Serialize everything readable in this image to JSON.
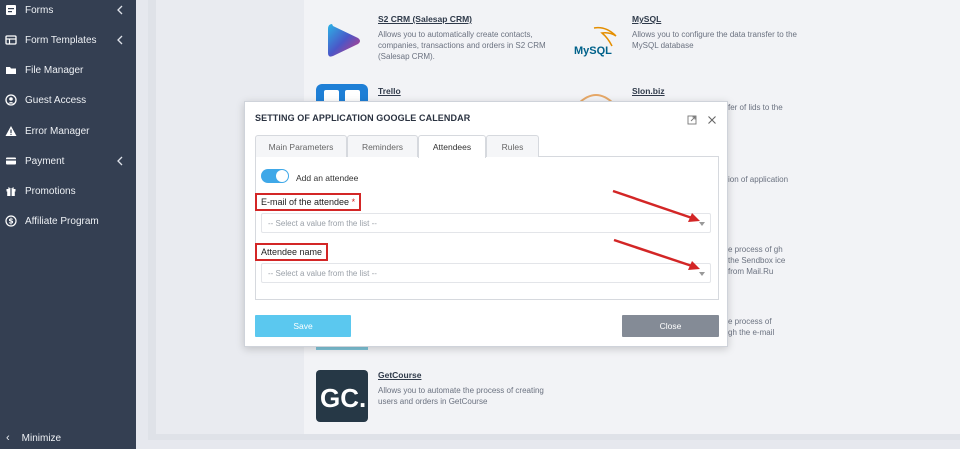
{
  "sidebar": {
    "items": [
      {
        "label": "Forms",
        "icon": "form-icon",
        "chevron": true
      },
      {
        "label": "Form Templates",
        "icon": "template-icon",
        "chevron": true
      },
      {
        "label": "File Manager",
        "icon": "folder-icon",
        "chevron": false
      },
      {
        "label": "Guest Access",
        "icon": "user-circle-icon",
        "chevron": false
      },
      {
        "label": "Error Manager",
        "icon": "warning-icon",
        "chevron": false
      },
      {
        "label": "Payment",
        "icon": "card-icon",
        "chevron": true
      },
      {
        "label": "Promotions",
        "icon": "gift-icon",
        "chevron": false
      },
      {
        "label": "Affiliate Program",
        "icon": "dollar-icon",
        "chevron": false
      }
    ],
    "minimize_label": "Minimize"
  },
  "integrations": {
    "s2crm": {
      "title": "S2 CRM (Salesap CRM)",
      "description": "Allows you to automatically create contacts, companies, transactions and orders in S2 CRM (Salesap CRM)."
    },
    "mysql": {
      "title": "MySQL",
      "description": "Allows you to configure the data transfer to the MySQL database",
      "logo_text": "MySQL"
    },
    "trello": {
      "title": "Trello"
    },
    "slon": {
      "title": "Slon.biz",
      "description_fragment": "fer of lids to the"
    },
    "frag1": {
      "text": "ion of application"
    },
    "frag2": {
      "text": "e process of gh the Sendbox ice from Mail.Ru"
    },
    "frag3": {
      "text": "e process of gh the e-mail"
    },
    "getcourse": {
      "title": "GetCourse",
      "description": "Allows you to automate the process of creating users and orders in GetCourse",
      "logo_text": "GC."
    }
  },
  "modal": {
    "title": "SETTING OF APPLICATION GOOGLE CALENDAR",
    "tabs": [
      "Main Parameters",
      "Reminders",
      "Attendees",
      "Rules"
    ],
    "active_tab": "Attendees",
    "toggle_label": "Add an attendee",
    "toggle_on": true,
    "email_label": "E-mail of the attendee",
    "required_mark": "*",
    "email_placeholder": "-- Select a value from the list --",
    "name_label": "Attendee name",
    "name_placeholder": "-- Select a value from the list --",
    "save_label": "Save",
    "close_label": "Close"
  },
  "colors": {
    "sidebar_bg": "#343f52",
    "accent": "#3fa8e8",
    "save_button": "#5bc8ef",
    "close_button": "#848b96",
    "annotation_red": "#d32626"
  }
}
